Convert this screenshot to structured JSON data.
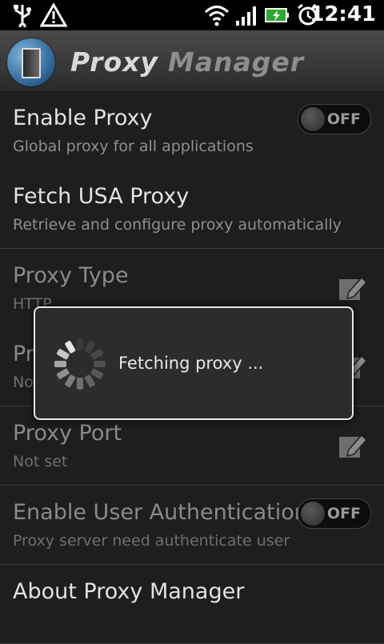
{
  "status_bar": {
    "time": "12:41",
    "icons": [
      "usb-icon",
      "warning-icon",
      "wifi-icon",
      "signal-icon",
      "battery-charging-icon",
      "alarm-icon"
    ]
  },
  "app": {
    "title_part1": "Proxy",
    "title_part2": "Manager"
  },
  "settings": [
    {
      "title": "Enable Proxy",
      "summary": "Global proxy for all applications",
      "toggle": "OFF"
    },
    {
      "title": "Fetch USA Proxy",
      "summary": "Retrieve and configure proxy automatically"
    },
    {
      "title": "Proxy Type",
      "summary": "HTTP"
    },
    {
      "title": "Pr",
      "summary": "No"
    },
    {
      "title": "Proxy Port",
      "summary": "Not set"
    },
    {
      "title": "Enable User Authentication",
      "summary": "Proxy server need authenticate user",
      "toggle": "OFF"
    },
    {
      "title": "About Proxy Manager",
      "summary": ""
    }
  ],
  "dialog": {
    "message": "Fetching proxy ..."
  },
  "colors": {
    "background": "#1e1e1e",
    "title_primary": "#d8d8d8",
    "title_secondary": "#8e8e8e",
    "dialog_border": "#e8e8e8"
  }
}
